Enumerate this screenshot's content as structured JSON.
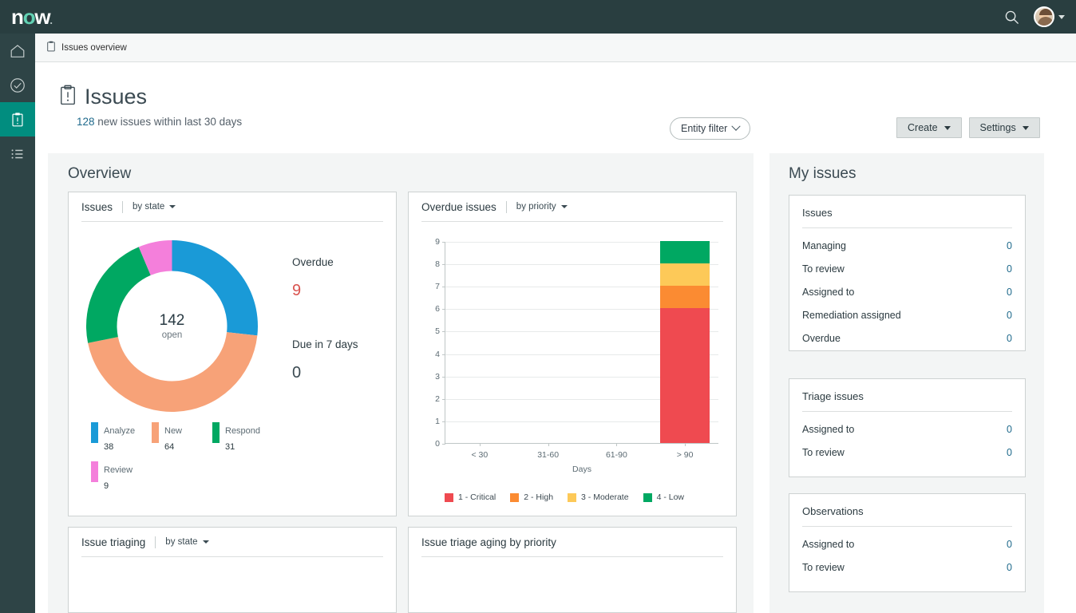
{
  "topbar": {
    "logo": "now",
    "search_icon": "search-icon",
    "avatar_icon": "user-avatar",
    "chevron_icon": "chevron-down-icon"
  },
  "breadcrumb": {
    "icon": "clipboard-icon",
    "label": "Issues overview"
  },
  "header": {
    "icon": "clipboard-alert-icon",
    "title": "Issues",
    "subtitle_count": "128",
    "subtitle_rest": " new issues within last 30 days",
    "entity_filter": "Entity filter",
    "create_button": "Create",
    "settings_button": "Settings"
  },
  "sidebar": {
    "items": [
      {
        "name": "sidebar-item-home",
        "icon": "home-icon",
        "active": false
      },
      {
        "name": "sidebar-item-tasks",
        "icon": "check-circle-icon",
        "active": false
      },
      {
        "name": "sidebar-item-issues",
        "icon": "clipboard-alert-icon",
        "active": true
      },
      {
        "name": "sidebar-item-list",
        "icon": "list-icon",
        "active": false
      }
    ]
  },
  "overview": {
    "title": "Overview",
    "issues_card": {
      "title": "Issues",
      "grouping": "by state",
      "center_value": "142",
      "center_label": "open",
      "overdue_label": "Overdue",
      "overdue_value": "9",
      "due7_label": "Due in 7 days",
      "due7_value": "0"
    },
    "overdue_card": {
      "title": "Overdue issues",
      "grouping": "by priority"
    },
    "triaging_card": {
      "title": "Issue triaging",
      "grouping": "by state"
    },
    "aging_card": {
      "title": "Issue triage aging by priority"
    }
  },
  "my_issues": {
    "title": "My issues",
    "cards": [
      {
        "title": "Issues",
        "rows": [
          {
            "label": "Managing",
            "value": "0"
          },
          {
            "label": "To review",
            "value": "0"
          },
          {
            "label": "Assigned to",
            "value": "0"
          },
          {
            "label": "Remediation assigned",
            "value": "0"
          },
          {
            "label": "Overdue",
            "value": "0"
          }
        ]
      },
      {
        "title": "Triage issues",
        "rows": [
          {
            "label": "Assigned to",
            "value": "0"
          },
          {
            "label": "To review",
            "value": "0"
          }
        ]
      },
      {
        "title": "Observations",
        "rows": [
          {
            "label": "Assigned to",
            "value": "0"
          },
          {
            "label": "To review",
            "value": "0"
          }
        ]
      }
    ]
  },
  "colors": {
    "brand_dark": "#293e40",
    "rail": "#2e4446",
    "active_teal": "#018d7f",
    "link": "#1f6a8c",
    "panel_bg": "#f3f5f5"
  },
  "chart_data": [
    {
      "type": "pie",
      "title": "Issues",
      "subtitle": "by state",
      "center_value": 142,
      "center_label": "open",
      "total": 142,
      "categories": [
        "Analyze",
        "New",
        "Respond",
        "Review"
      ],
      "values": [
        38,
        64,
        31,
        9
      ],
      "colors": [
        "#1a9ad7",
        "#f7a278",
        "#00a862",
        "#f47fdb"
      ],
      "legend_position": "bottom",
      "annotations": [
        {
          "label": "Overdue",
          "value": 9
        },
        {
          "label": "Due in 7 days",
          "value": 0
        }
      ]
    },
    {
      "type": "bar",
      "title": "Overdue issues",
      "subtitle": "by priority",
      "stacked": true,
      "xlabel": "Days",
      "ylabel": "",
      "categories": [
        "< 30",
        "31-60",
        "61-90",
        "> 90"
      ],
      "ylim": [
        0,
        9
      ],
      "yticks": [
        0,
        1,
        2,
        3,
        4,
        5,
        6,
        7,
        8,
        9
      ],
      "grid": true,
      "legend_position": "bottom",
      "series": [
        {
          "name": "1 - Critical",
          "color": "#ef4a50",
          "values": [
            0,
            0,
            0,
            6
          ]
        },
        {
          "name": "2 - High",
          "color": "#fb8b32",
          "values": [
            0,
            0,
            0,
            1
          ]
        },
        {
          "name": "3 - Moderate",
          "color": "#fdc958",
          "values": [
            0,
            0,
            0,
            1
          ]
        },
        {
          "name": "4 - Low",
          "color": "#00a862",
          "values": [
            0,
            0,
            0,
            1
          ]
        }
      ]
    }
  ]
}
